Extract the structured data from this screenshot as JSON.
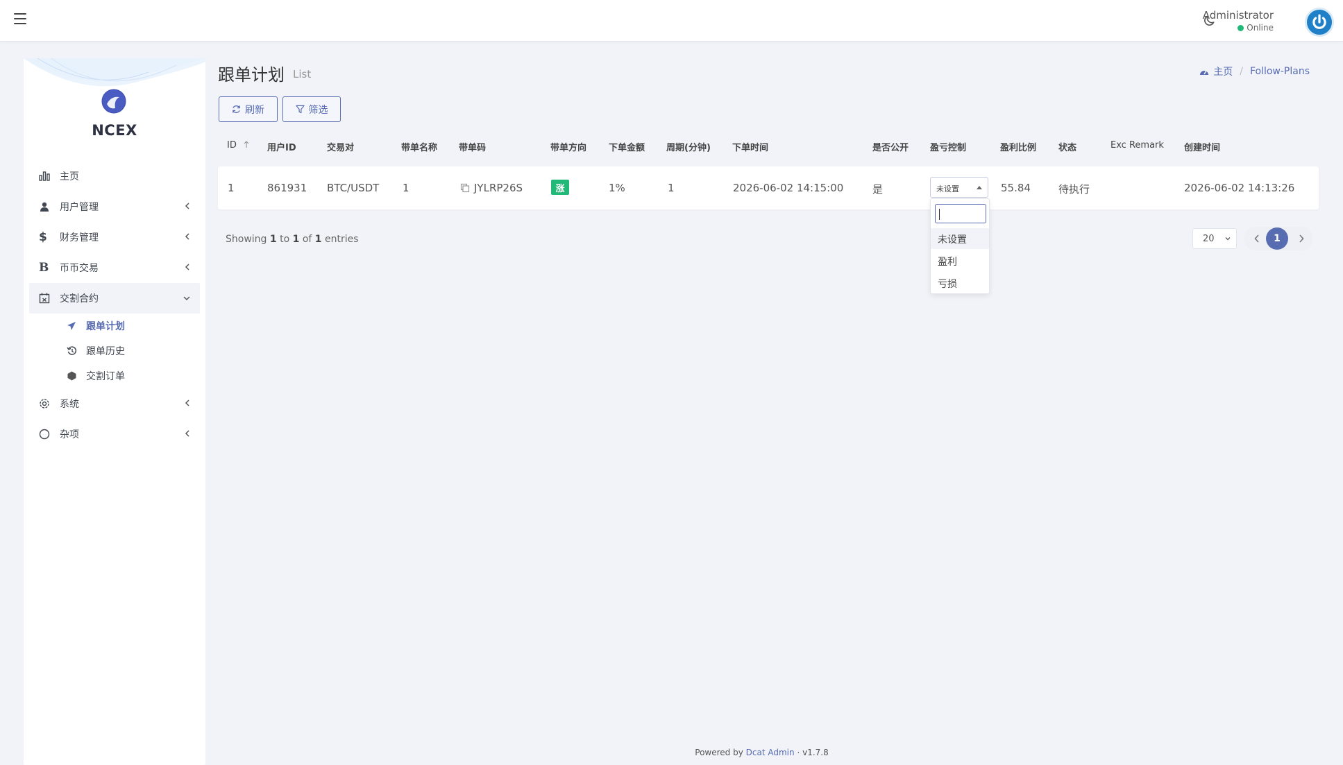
{
  "header": {
    "user_name": "Administrator",
    "user_status": "Online"
  },
  "sidebar": {
    "brand": "NCEX",
    "items": [
      {
        "label": "主页",
        "icon": "bar-chart-icon"
      },
      {
        "label": "用户管理",
        "icon": "users-icon"
      },
      {
        "label": "财务管理",
        "icon": "dollar-icon"
      },
      {
        "label": "币币交易",
        "icon": "bitcoin-icon"
      },
      {
        "label": "交割合约",
        "icon": "calendar-icon"
      },
      {
        "label": "系统",
        "icon": "gear-icon"
      },
      {
        "label": "杂项",
        "icon": "circle-icon"
      }
    ],
    "submenu": [
      {
        "label": "跟单计划",
        "icon": "plane-icon"
      },
      {
        "label": "跟单历史",
        "icon": "history-icon"
      },
      {
        "label": "交割订单",
        "icon": "cube-icon"
      }
    ]
  },
  "page": {
    "title": "跟单计划",
    "subtitle": "List",
    "breadcrumb_home": "主页",
    "breadcrumb_current": "Follow-Plans"
  },
  "toolbar": {
    "refresh_label": "刷新",
    "filter_label": "筛选"
  },
  "table": {
    "headers": [
      "ID",
      "用户ID",
      "交易对",
      "带单名称",
      "带单码",
      "带单方向",
      "下单金额",
      "周期(分钟)",
      "下单时间",
      "是否公开",
      "盈亏控制",
      "盈利比例",
      "状态",
      "Exc Remark",
      "创建时间"
    ],
    "row": {
      "id": "1",
      "user_id": "861931",
      "pair": "BTC/USDT",
      "name": "1",
      "code": "JYLRP26S",
      "direction": "涨",
      "amount": "1%",
      "period": "1",
      "order_time": "2026-06-02 14:15:00",
      "public": "是",
      "pnl_control": "未设置",
      "profit_ratio": "55.84",
      "status": "待执行",
      "remark": "",
      "created_at": "2026-06-02 14:13:26"
    }
  },
  "dropdown": {
    "options": [
      "未设置",
      "盈利",
      "亏损"
    ]
  },
  "pagination": {
    "showing_prefix": "Showing",
    "from": "1",
    "to_word": "to",
    "to": "1",
    "of_word": "of",
    "total": "1",
    "entries_word": "entries",
    "per_page": "20",
    "current_page": "1"
  },
  "footer": {
    "powered_by": "Powered by",
    "brand_link": "Dcat Admin",
    "version": "v1.7.8"
  },
  "colors": {
    "accent": "#586cb1",
    "success": "#21b978",
    "background": "#f1f3f8"
  }
}
